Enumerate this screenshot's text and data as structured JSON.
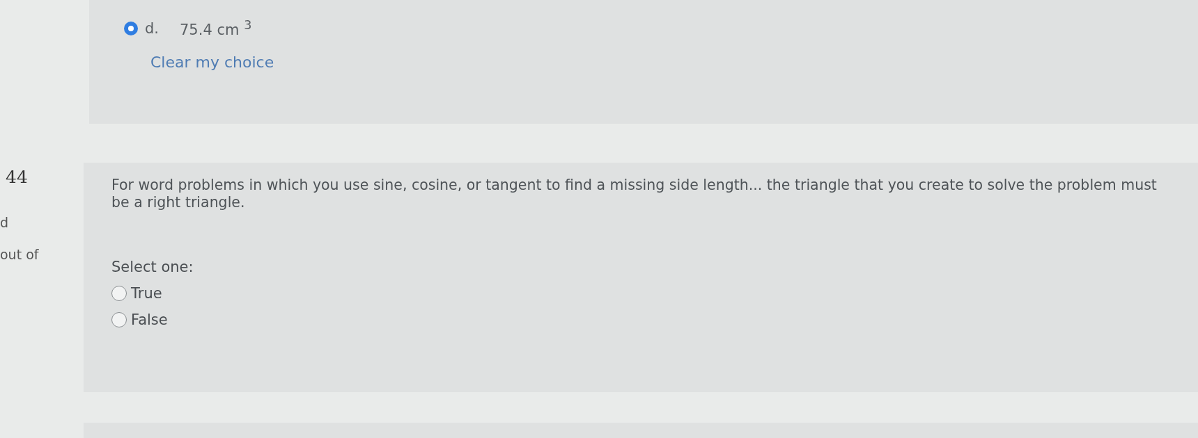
{
  "previous_question": {
    "options": [
      {
        "letter": "d.",
        "text": "75.4 cm $^{3}$",
        "selected": true
      }
    ],
    "clear_link": "Clear my choice"
  },
  "question": {
    "number": "44",
    "status": "d",
    "marks": "out of",
    "text": "For word problems in which you use sine, cosine, or tangent to find a missing side length... the triangle that you create to solve the problem must be a right triangle.",
    "prompt": "Select one:",
    "options": [
      {
        "label": "True",
        "selected": false
      },
      {
        "label": "False",
        "selected": false
      }
    ]
  }
}
